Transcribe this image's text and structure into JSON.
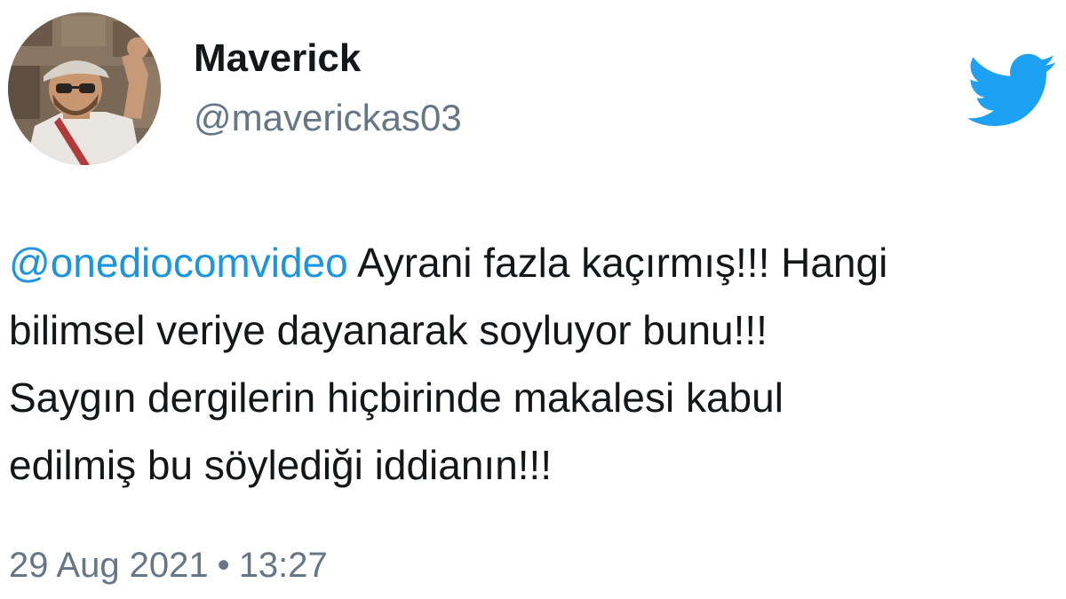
{
  "author": {
    "display_name": "Maverick",
    "handle": "@maverickas03"
  },
  "brand": {
    "icon": "twitter-bird-icon",
    "color": "#1da1f2"
  },
  "tweet": {
    "mention": "@onediocomvideo",
    "line1_rest": " Ayrani fazla kaçırmış!!! Hangi",
    "line2": "bilimsel veriye dayanarak soyluyor bunu!!!",
    "line3": "Saygın dergilerin hiçbirinde makalesi kabul",
    "line4": "edilmiş bu söylediği iddianın!!!"
  },
  "meta": {
    "date": "29 Aug 2021",
    "separator": "•",
    "time": "13:27"
  },
  "colors": {
    "text": "#14171a",
    "secondary": "#657786",
    "link": "#1b95e0"
  }
}
